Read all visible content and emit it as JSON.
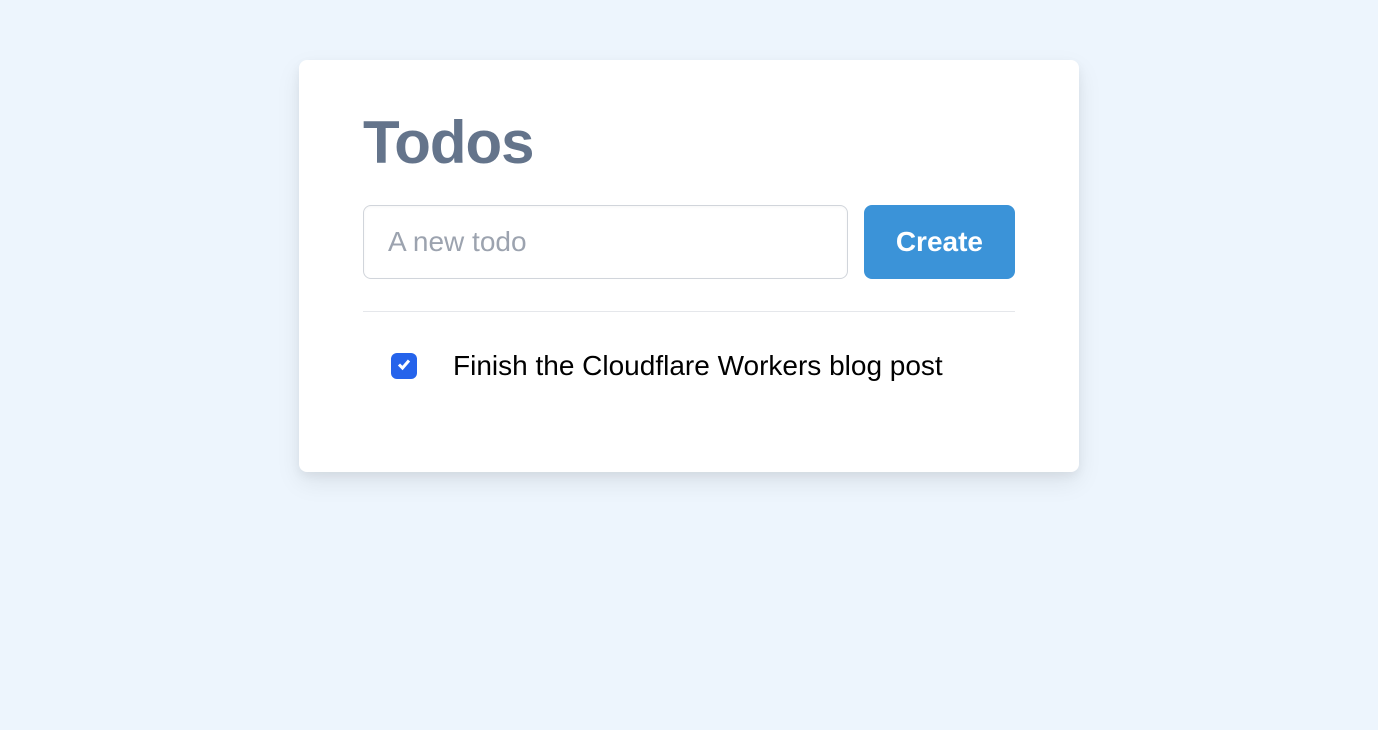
{
  "title": "Todos",
  "input": {
    "placeholder": "A new todo",
    "value": ""
  },
  "create_button_label": "Create",
  "todos": [
    {
      "text": "Finish the Cloudflare Workers blog post",
      "completed": true
    }
  ]
}
